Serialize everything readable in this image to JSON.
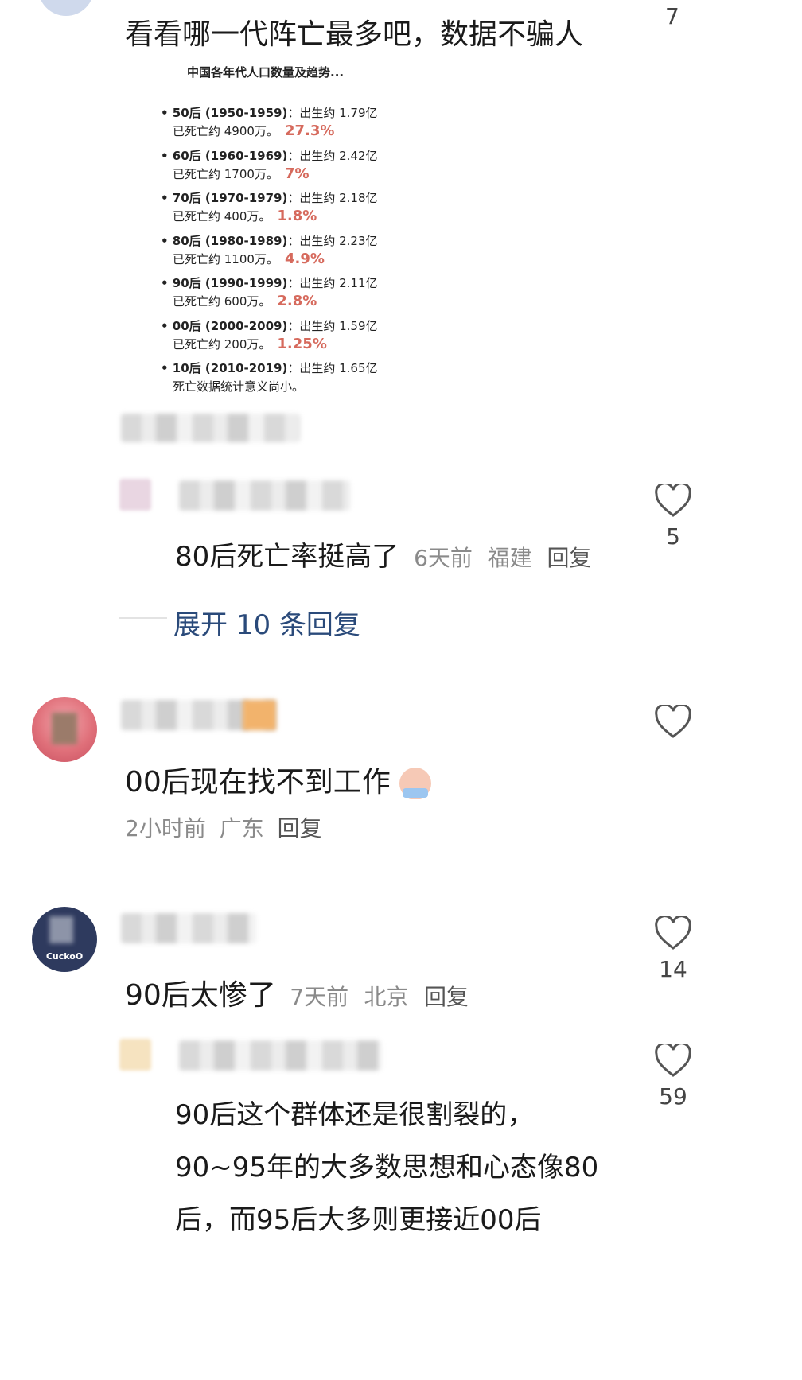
{
  "top_comment": {
    "text": "看看哪一代阵亡最多吧，数据不骗人",
    "likes": "7",
    "time_blur": "6天前",
    "image": {
      "title": "中国各年代人口数量及趋势...",
      "rows": [
        {
          "gen": "• 50后 (1950-1959)",
          "birth": "：出生约 1.79亿",
          "dead": "已死亡约 4900万。",
          "pct": "27.3%"
        },
        {
          "gen": "• 60后 (1960-1969)",
          "birth": "：出生约 2.42亿",
          "dead": "已死亡约 1700万。",
          "pct": "7%"
        },
        {
          "gen": "• 70后 (1970-1979)",
          "birth": "：出生约 2.18亿",
          "dead": "已死亡约 400万。",
          "pct": "1.8%"
        },
        {
          "gen": "• 80后 (1980-1989)",
          "birth": "：出生约 2.23亿",
          "dead": "已死亡约 1100万。",
          "pct": "4.9%"
        },
        {
          "gen": "• 90后 (1990-1999)",
          "birth": "：出生约 2.11亿",
          "dead": "已死亡约 600万。",
          "pct": "2.8%"
        },
        {
          "gen": "• 00后 (2000-2009)",
          "birth": "：出生约 1.59亿",
          "dead": "已死亡约 200万。",
          "pct": "1.25%"
        },
        {
          "gen": "• 10后 (2010-2019)",
          "birth": "：出生约 1.65亿",
          "dead": "死亡数据统计意义尚小。",
          "pct": ""
        }
      ]
    }
  },
  "reply1": {
    "text": "80后死亡率挺高了",
    "time": "6天前",
    "location": "福建",
    "reply_label": "回复",
    "likes": "5"
  },
  "expand": {
    "label": "展开 10 条回复"
  },
  "comment2": {
    "text": "00后现在找不到工作",
    "time": "2小时前",
    "location": "广东",
    "reply_label": "回复"
  },
  "comment3": {
    "avatar_text": "CuckoO",
    "text": "90后太惨了",
    "time": "7天前",
    "location": "北京",
    "reply_label": "回复",
    "likes": "14"
  },
  "reply2": {
    "lines": [
      "90后这个群体还是很割裂的，",
      "90~95年的大多数思想和心态像80",
      "后，而95后大多则更接近00后"
    ],
    "likes": "59"
  },
  "colors": {
    "accent": "#2a4a7a",
    "meta": "#8a8a8a",
    "pct": "#d66a5d"
  }
}
